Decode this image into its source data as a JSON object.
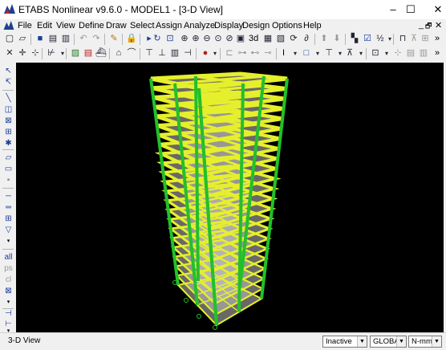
{
  "window": {
    "title": "ETABS Nonlinear v9.6.0 - MODEL1 - [3-D View]",
    "minimize": "–",
    "maximize": "☐",
    "close": "✕"
  },
  "menu": [
    "File",
    "Edit",
    "View",
    "Define",
    "Draw",
    "Select",
    "Assign",
    "Analyze",
    "Display",
    "Design",
    "Options",
    "Help"
  ],
  "mdi": {
    "minimize": "_",
    "restore": "🗗",
    "close": "✕"
  },
  "toolbar1": {
    "view_3d": "3d",
    "plan": "plan",
    "elev": "elev"
  },
  "toolbar2": {
    "dims": "I",
    "chevron": "»"
  },
  "statusbar": {
    "status": "3-D View",
    "mode": "Inactive",
    "coord": "GLOBAL",
    "units": "N-mm"
  },
  "colors": {
    "frame": "#e6ef2c",
    "column": "#22c02a",
    "slab": "#bdbdbd",
    "background": "#000000"
  }
}
